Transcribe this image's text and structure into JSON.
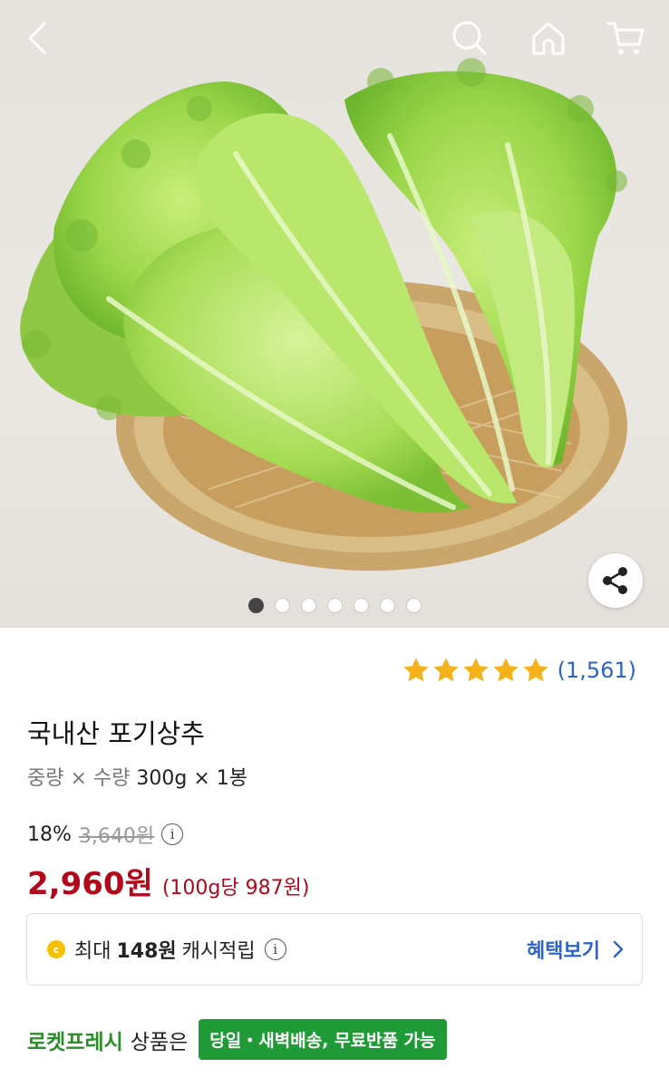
{
  "header": {
    "back_icon": "chevron-left-icon",
    "search_icon": "search-icon",
    "home_icon": "home-icon",
    "cart_icon": "cart-icon"
  },
  "gallery": {
    "image_description_icon": "lettuce-on-basket-photo",
    "dots_total": 7,
    "dots_active_index": 0,
    "share_icon": "share-icon"
  },
  "product": {
    "rating_count": "(1,561)",
    "rating_stars": 5,
    "title": "국내산 포기상추",
    "spec_label": "중량 × 수량",
    "spec_value": "300g × 1봉",
    "discount_rate": "18%",
    "original_price": "3,640원",
    "price": "2,960원",
    "unit_price": "(100g당 987원)"
  },
  "cashback": {
    "prefix": "최대",
    "amount": "148원",
    "suffix": "캐시적립",
    "link_label": "혜택보기"
  },
  "rocket": {
    "name": "로켓프레시",
    "suffix": "상품은",
    "badge": "당일・새벽배송, 무료반품 가능"
  },
  "colors": {
    "price_red": "#b3071b",
    "link_blue": "#2c64c9",
    "star_yellow": "#f6b21b",
    "rocket_green": "#209a36"
  }
}
